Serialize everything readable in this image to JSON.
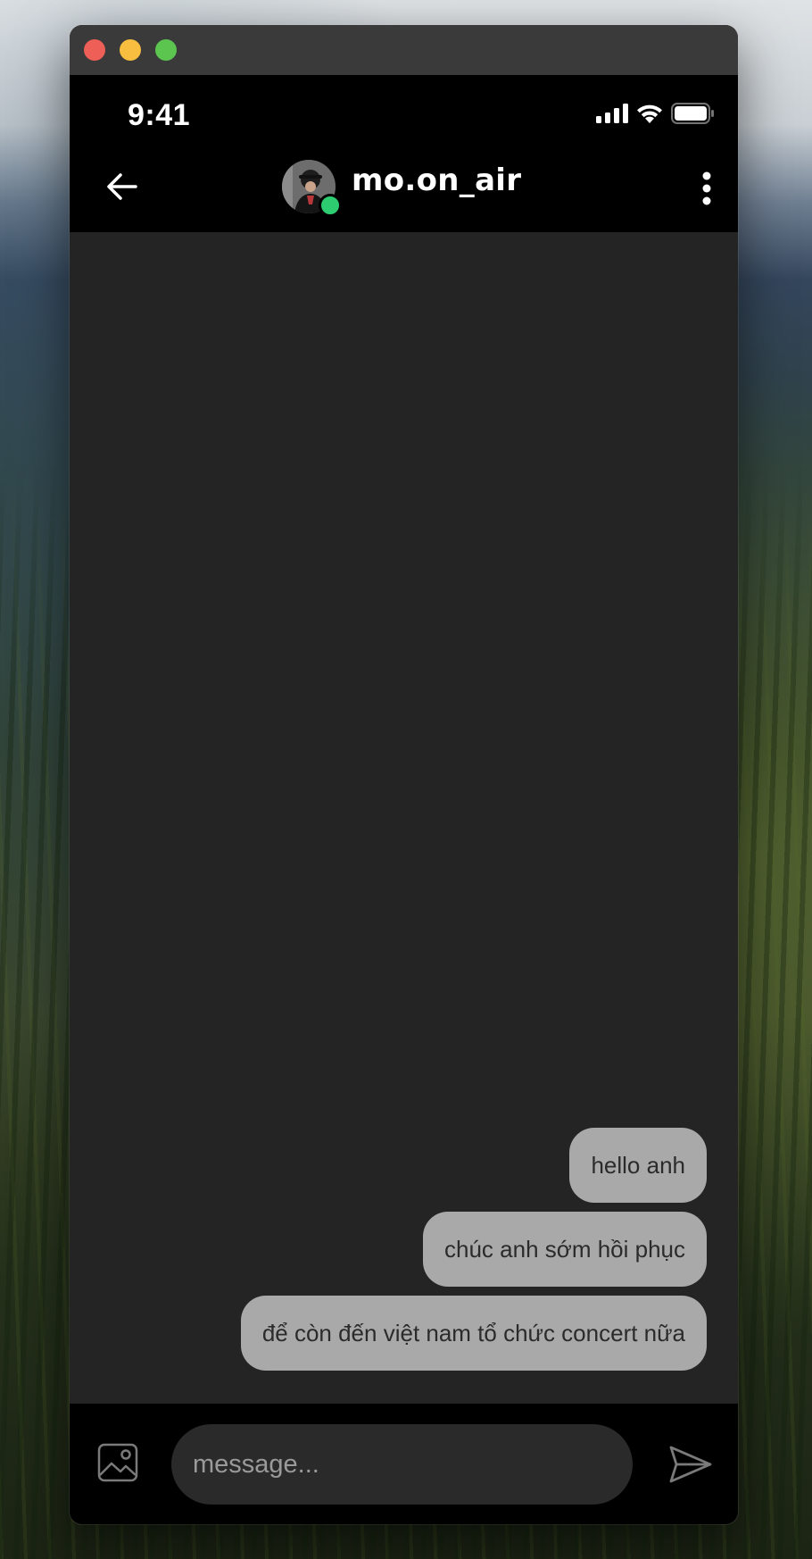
{
  "window": {
    "controls": [
      "close",
      "minimize",
      "maximize"
    ]
  },
  "status_bar": {
    "time": "9:41",
    "icons": [
      "signal-icon",
      "wifi-icon",
      "battery-icon"
    ]
  },
  "header": {
    "back_icon": "arrow-left-icon",
    "username": "mo.on_air",
    "online": true,
    "online_color": "#2ecc71",
    "more_icon": "more-vertical-icon"
  },
  "messages": [
    {
      "text": "hello anh",
      "outgoing": true
    },
    {
      "text": "chúc anh sớm hồi phục",
      "outgoing": true
    },
    {
      "text": "để còn đến việt nam tổ chức concert nữa",
      "outgoing": true
    }
  ],
  "composer": {
    "image_icon": "image-icon",
    "placeholder": "message...",
    "value": "",
    "send_icon": "send-icon"
  },
  "colors": {
    "bubble": "#a9a9a9",
    "chat_background": "#242424",
    "bars": "#000000"
  }
}
